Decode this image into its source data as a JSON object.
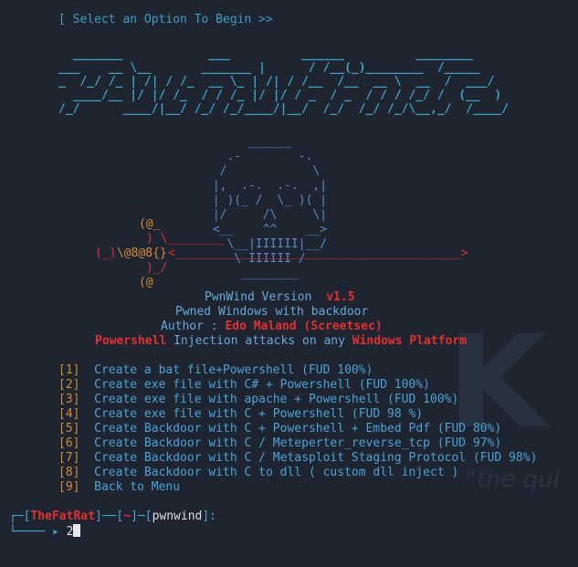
{
  "header": {
    "prompt": "[ Select an Option To Begin >>"
  },
  "banner_art": [
    "  _______            ___          ______          ________",
    "___    __ \\__       _______ |      / /__(_)________  /_____",
    "_  /_/ /_ | /| / /_  __ \\_ | /| / /__  /__  __ \\  __  /  ___/",
    "  ____/__ |/ |/ /_  / / /_ |/ |/ / _  / _  / / / /_/ /  (__  )",
    "/_/      ____/|__/ /_/ /_/____/|__/  /_/  /_/ /_/\\__,_/  /____/"
  ],
  "skull_art": [
    "      ______",
    "   .-        -.",
    "  /            \\",
    " |,  .-.  .-.  ,|",
    " | )(_ /  \\_ )( |",
    " |/     /\\     \\|",
    " <__    ^^    __>",
    "   \\__|IIIIII|__/",
    "    \\ IIIIII /",
    "     ________"
  ],
  "bones": {
    "top_at": "(@_",
    "row_right": ") \\________",
    "mid_left": "(_)",
    "mid_at": "\\@8@8{}",
    "mid_bar": "<________________________________________>",
    "low": ")_/",
    "bottom_at": "(@"
  },
  "info": {
    "title": "PwnWind Version",
    "version": "v1.5",
    "subtitle": "Pwned Windows with backdoor",
    "author_label": "Author :",
    "author_name": "Edo Maland (Screetsec)",
    "line4_a": "Powershell",
    "line4_b": "Injection attacks on any",
    "line4_c": "Windows Platform"
  },
  "menu": [
    {
      "num": "[1]",
      "label": "Create a bat file+Powershell (FUD 100%)"
    },
    {
      "num": "[2]",
      "label": "Create exe file with C# + Powershell (FUD 100%)"
    },
    {
      "num": "[3]",
      "label": "Create exe file with apache + Powershell (FUD 100%)"
    },
    {
      "num": "[4]",
      "label": "Create exe file with C + Powershell (FUD 98 %)"
    },
    {
      "num": "[5]",
      "label": "Create Backdoor with C + Powershell + Embed Pdf (FUD 80%)"
    },
    {
      "num": "[6]",
      "label": "Create Backdoor with C / Meteperter_reverse_tcp (FUD 97%)"
    },
    {
      "num": "[7]",
      "label": "Create Backdoor with C / Metasploit Staging Protocol (FUD 98%)"
    },
    {
      "num": "[8]",
      "label": "Create Backdoor with C to dll ( custom dll inject )"
    },
    {
      "num": "[9]",
      "label": "Back to Menu"
    }
  ],
  "prompt": {
    "prefix": "┌─[",
    "app": "TheFatRat",
    "mid1": "]──[",
    "tilde": "~",
    "mid2": "]─[",
    "dir": "pwnwind",
    "suffix": "]:",
    "arrow": "└──── ▸",
    "input": "2"
  },
  "watermark": {
    "letter": "K",
    "text": "\"the qui"
  },
  "colors": {
    "background": "#1e2430",
    "cyan": "#3d9ec9",
    "orange": "#d98c30",
    "red": "#e0302f",
    "blue": "#4f7fd1"
  }
}
